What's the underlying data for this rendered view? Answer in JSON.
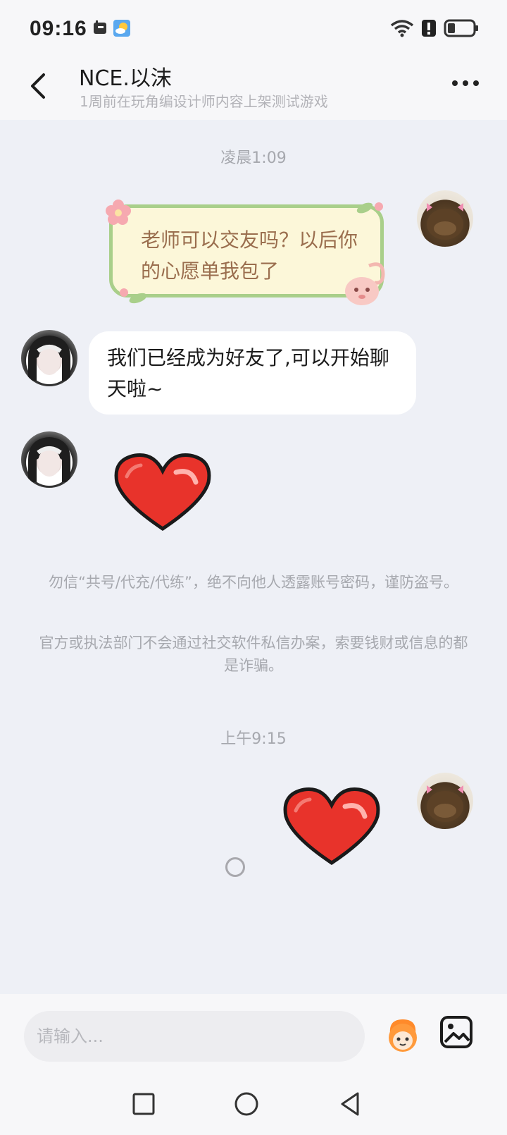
{
  "status_bar": {
    "time": "09:16",
    "left_icons": [
      "notification-app-icon",
      "weather-icon"
    ],
    "right_icons": [
      "wifi-icon",
      "alert-icon",
      "battery-icon"
    ]
  },
  "header": {
    "name": "NCE.以沫",
    "subtitle": "1周前在玩角编设计师内容上架测试游戏"
  },
  "messages": {
    "time1": "凌晨1:09",
    "sticker_text": "老师可以交友吗？以后你的心愿单我包了",
    "friend_text": "我们已经成为好友了,可以开始聊天啦~",
    "warning1": "勿信“共号/代充/代练”，绝不向他人透露账号密码，谨防盗号。",
    "warning2": "官方或执法部门不会通过社交软件私信办案，索要钱财或信息的都是诈骗。",
    "time2": "上午9:15"
  },
  "input": {
    "placeholder": "请输入..."
  },
  "colors": {
    "background": "#eef0f6",
    "sticker_border": "#a9cf8a",
    "sticker_fill": "#fcf7d9",
    "sticker_text": "#9a6e4e",
    "heart": "#e8332b"
  }
}
